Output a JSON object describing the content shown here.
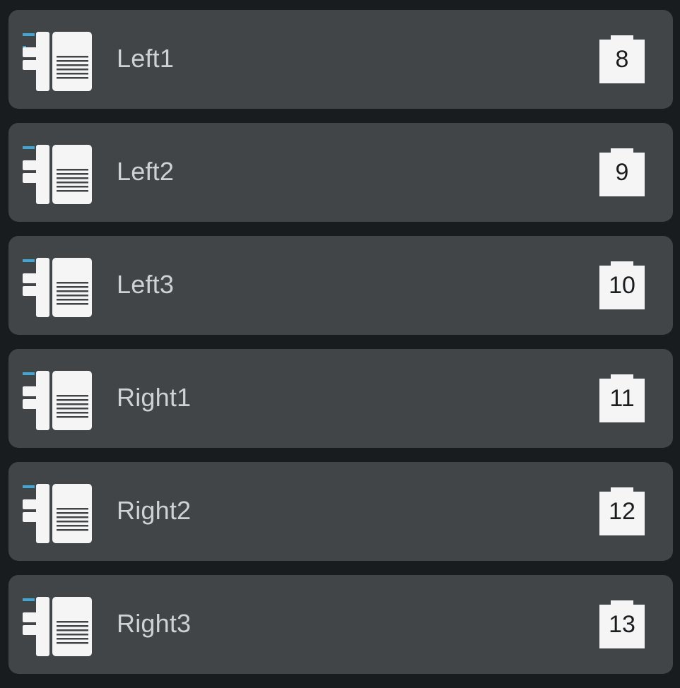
{
  "colors": {
    "background": "#181c1e",
    "row": "#414548",
    "text": "#cfd2d3",
    "icon": "#f5f5f5",
    "accent": "#3fa7d6"
  },
  "icons": {
    "row_icon": "panel-module-icon",
    "badge_icon": "port-badge-icon"
  },
  "items": [
    {
      "label": "Left1",
      "number": "8"
    },
    {
      "label": "Left2",
      "number": "9"
    },
    {
      "label": "Left3",
      "number": "10"
    },
    {
      "label": "Right1",
      "number": "11"
    },
    {
      "label": "Right2",
      "number": "12"
    },
    {
      "label": "Right3",
      "number": "13"
    }
  ]
}
